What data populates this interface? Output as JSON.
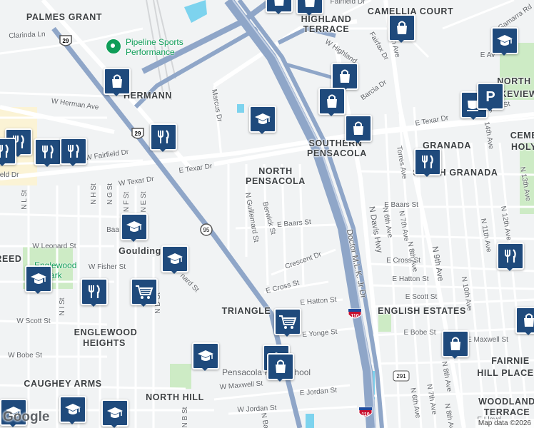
{
  "map": {
    "areas": [
      {
        "text": "PALMES GRANT"
      },
      {
        "text": "CAMELLIA COURT"
      },
      {
        "text": "HIGHLAND"
      },
      {
        "text": "TERRACE"
      },
      {
        "text": "HERMANN"
      },
      {
        "text": "NORTH"
      },
      {
        "text": "LAKEVIEW"
      },
      {
        "text": "CEME"
      },
      {
        "text": "HOLY"
      },
      {
        "text": "SOUTHERN"
      },
      {
        "text": "PENSACOLA"
      },
      {
        "text": "NORTH"
      },
      {
        "text": "PENSACOLA"
      },
      {
        "text": "GRANADA"
      },
      {
        "text": "SOUTH GRANADA"
      },
      {
        "text": "Goulding"
      },
      {
        "text": "REED"
      },
      {
        "text": "TRIANGLE"
      },
      {
        "text": "ENGLISH ESTATES"
      },
      {
        "text": "ENGLEWOOD"
      },
      {
        "text": "HEIGHTS"
      },
      {
        "text": "CAUGHEY ARMS"
      },
      {
        "text": "NORTH HILL"
      },
      {
        "text": "FAIRNIE"
      },
      {
        "text": "HILL PLACE"
      },
      {
        "text": "WOODLAND"
      },
      {
        "text": "TERRACE"
      }
    ],
    "streets": [
      {
        "text": "Clarinda Ln"
      },
      {
        "text": "Fairfield Dr"
      },
      {
        "text": "W Highland"
      },
      {
        "text": "Fairfax Dr"
      },
      {
        "text": "Barcia Dr"
      },
      {
        "text": "E 9th Ave"
      },
      {
        "text": "Gamarra Rd"
      },
      {
        "text": "E Texar Dr"
      },
      {
        "text": "Torres Ave"
      },
      {
        "text": "W Herman Ave"
      },
      {
        "text": "Marcus Dr"
      },
      {
        "text": "W Fairfield Dr"
      },
      {
        "text": "W Texar Dr"
      },
      {
        "text": "E Texar Dr"
      },
      {
        "text": "ield Dr"
      },
      {
        "text": "N Guillemard St"
      },
      {
        "text": "Berwick St"
      },
      {
        "text": "E Baars St"
      },
      {
        "text": "E Baars St"
      },
      {
        "text": "Baa"
      },
      {
        "text": "W Leonard St"
      },
      {
        "text": "W Fisher St"
      },
      {
        "text": "nard St"
      },
      {
        "text": "Crescent Dr"
      },
      {
        "text": "E Cross St"
      },
      {
        "text": "E Cross St"
      },
      {
        "text": "E Hatton St"
      },
      {
        "text": "E Hatton St"
      },
      {
        "text": "E Scott St"
      },
      {
        "text": "W Scott St"
      },
      {
        "text": "E Yonge St"
      },
      {
        "text": "E Bobe St"
      },
      {
        "text": "E Maxwell St"
      },
      {
        "text": "W Bobe St"
      },
      {
        "text": "W Maxwell St"
      },
      {
        "text": "W Jordan St"
      },
      {
        "text": "E Jordan St"
      },
      {
        "text": "Doctor M.L.K. Jr Dr"
      },
      {
        "text": "N Davis Hwy"
      },
      {
        "text": "N 6th Ave"
      },
      {
        "text": "N 7th Ave"
      },
      {
        "text": "N 8th Ave"
      },
      {
        "text": "N 9th Ave"
      },
      {
        "text": "N 10th Ave"
      },
      {
        "text": "N 11th Ave"
      },
      {
        "text": "N 12th Ave"
      },
      {
        "text": "N 13th Ave"
      },
      {
        "text": "14th Ave"
      },
      {
        "text": "N 6th Ave"
      },
      {
        "text": "N 7th Ave"
      },
      {
        "text": "N 8th Ave"
      },
      {
        "text": "N 8th Ave"
      },
      {
        "text": "N H St"
      },
      {
        "text": "N G St"
      },
      {
        "text": "N F St"
      },
      {
        "text": "N E St"
      },
      {
        "text": "N L St"
      },
      {
        "text": "N I St"
      },
      {
        "text": "N D St"
      },
      {
        "text": "N B St"
      },
      {
        "text": "N Ba"
      },
      {
        "text": "E Lloyd"
      },
      {
        "text": "ynis St"
      },
      {
        "text": "E Av"
      }
    ],
    "pois": [
      {
        "text": "Pipeline Sports Performance",
        "line1": "Pipeline Sports",
        "line2": "Performance"
      },
      {
        "text": "Englewood Park",
        "line1": "Englewood",
        "line2": "Park"
      },
      {
        "text": "Pensacola High School"
      }
    ],
    "shields": [
      {
        "label": "29",
        "type": "us"
      },
      {
        "label": "29",
        "type": "us"
      },
      {
        "label": "95",
        "type": "interstate-small"
      },
      {
        "label": "110",
        "type": "interstate"
      },
      {
        "label": "110",
        "type": "interstate"
      },
      {
        "label": "291",
        "type": "state"
      }
    ],
    "markers": [
      {
        "icon": "shopping-bag-icon"
      },
      {
        "icon": "shopping-bag-icon"
      },
      {
        "icon": "shopping-bag-icon"
      },
      {
        "icon": "graduation-cap-icon"
      },
      {
        "icon": "shopping-bag-icon"
      },
      {
        "icon": "shopping-bag-icon"
      },
      {
        "icon": "graduation-cap-icon"
      },
      {
        "icon": "shopping-bag-icon"
      },
      {
        "icon": "shopping-bag-icon"
      },
      {
        "icon": "coffee-cup-icon"
      },
      {
        "icon": "parking-icon"
      },
      {
        "icon": "restaurant-icon"
      },
      {
        "icon": "restaurant-icon"
      },
      {
        "icon": "restaurant-icon"
      },
      {
        "icon": "restaurant-icon"
      },
      {
        "icon": "restaurant-icon"
      },
      {
        "icon": "restaurant-icon"
      },
      {
        "icon": "graduation-cap-icon"
      },
      {
        "icon": "graduation-cap-icon"
      },
      {
        "icon": "graduation-cap-icon"
      },
      {
        "icon": "restaurant-icon"
      },
      {
        "icon": "shopping-cart-icon"
      },
      {
        "icon": "shopping-cart-icon"
      },
      {
        "icon": "graduation-cap-icon"
      },
      {
        "icon": "shopping-bag-icon"
      },
      {
        "icon": "graduation-cap-icon"
      },
      {
        "icon": "shopping-bag-icon"
      },
      {
        "icon": "restaurant-icon"
      },
      {
        "icon": "shopping-bag-icon"
      },
      {
        "icon": "graduation-cap-icon"
      },
      {
        "icon": "graduation-cap-icon"
      },
      {
        "icon": "graduation-cap-icon"
      }
    ],
    "attribution": "Map data ©2026",
    "logo": "Google",
    "colors": {
      "road": "#ffffff",
      "freeway": "#8fa6c8",
      "water": "#7dd3ee",
      "park": "#cdebc5",
      "marker": "#1f4a7c"
    }
  }
}
